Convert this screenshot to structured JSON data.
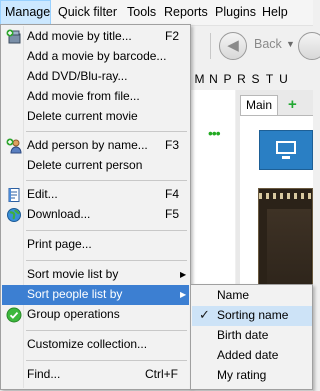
{
  "menubar": {
    "items": [
      {
        "label": "Manage",
        "active": true
      },
      {
        "label": "Quick filter"
      },
      {
        "label": "Tools"
      },
      {
        "label": "Reports"
      },
      {
        "label": "Plugins"
      },
      {
        "label": "Help"
      }
    ]
  },
  "toolbar": {
    "back_label": "Back"
  },
  "alpha_bar": [
    "M",
    "N",
    "P",
    "R",
    "S",
    "T",
    "U"
  ],
  "tabs": {
    "main": "Main"
  },
  "manage_menu": {
    "add_movie_by_title": {
      "label": "Add movie by title...",
      "shortcut": "F2"
    },
    "add_movie_by_barcode": {
      "label": "Add a movie by barcode..."
    },
    "add_dvd": {
      "label": "Add DVD/Blu-ray..."
    },
    "add_movie_from_file": {
      "label": "Add movie from file..."
    },
    "delete_current_movie": {
      "label": "Delete current movie"
    },
    "add_person_by_name": {
      "label": "Add person by name...",
      "shortcut": "F3"
    },
    "delete_current_person": {
      "label": "Delete current person"
    },
    "edit": {
      "label": "Edit...",
      "shortcut": "F4"
    },
    "download": {
      "label": "Download...",
      "shortcut": "F5"
    },
    "print_page": {
      "label": "Print page..."
    },
    "sort_movie_list_by": {
      "label": "Sort movie list by"
    },
    "sort_people_list_by": {
      "label": "Sort people list by"
    },
    "group_operations": {
      "label": "Group operations"
    },
    "customize_collection": {
      "label": "Customize collection..."
    },
    "find": {
      "label": "Find...",
      "shortcut": "Ctrl+F"
    }
  },
  "sort_people_submenu": {
    "items": [
      {
        "label": "Name",
        "checked": false
      },
      {
        "label": "Sorting name",
        "checked": true
      },
      {
        "label": "Birth date",
        "checked": false
      },
      {
        "label": "Added date",
        "checked": false
      },
      {
        "label": "My rating",
        "checked": false
      }
    ]
  },
  "colors": {
    "menu_highlight": "#3c7fd2",
    "menubar_active": "#cce8ff",
    "checked_item": "#cde3f7"
  }
}
